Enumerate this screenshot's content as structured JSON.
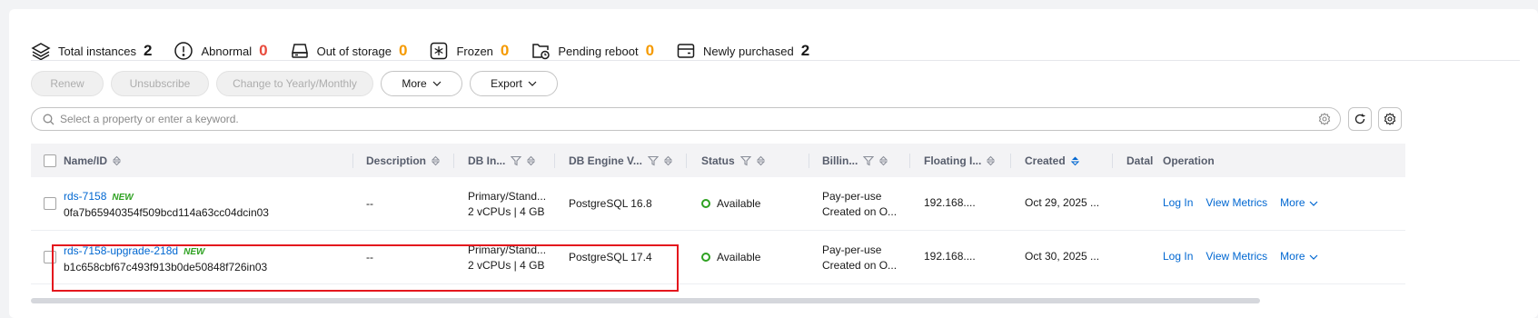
{
  "summary": [
    {
      "icon": "layers-icon",
      "label": "Total instances",
      "count": "2",
      "color": "black"
    },
    {
      "icon": "exclamation-circle-icon",
      "label": "Abnormal",
      "count": "0",
      "color": "red"
    },
    {
      "icon": "storage-icon",
      "label": "Out of storage",
      "count": "0",
      "color": "orange"
    },
    {
      "icon": "frozen-icon",
      "label": "Frozen",
      "count": "0",
      "color": "orange"
    },
    {
      "icon": "pending-reboot-icon",
      "label": "Pending reboot",
      "count": "0",
      "color": "orange"
    },
    {
      "icon": "wallet-icon",
      "label": "Newly purchased",
      "count": "2",
      "color": "black"
    }
  ],
  "toolbar": {
    "renew": "Renew",
    "unsubscribe": "Unsubscribe",
    "change": "Change to Yearly/Monthly",
    "more": "More",
    "export": "Export"
  },
  "search": {
    "placeholder": "Select a property or enter a keyword."
  },
  "columns": {
    "name": "Name/ID",
    "description": "Description",
    "db_instance": "DB In...",
    "engine": "DB Engine V...",
    "status": "Status",
    "billing": "Billin...",
    "floating": "Floating I...",
    "created": "Created",
    "datastore": "Datal",
    "operation": "Operation"
  },
  "rows": [
    {
      "name": "rds-7158",
      "tag": "NEW",
      "id": "0fa7b65940354f509bcd114a63cc04dcin03",
      "description": "--",
      "instance_type": "Primary/Stand...",
      "spec": "2 vCPUs | 4 GB",
      "engine": "PostgreSQL 16.8",
      "status": "Available",
      "billing_mode": "Pay-per-use",
      "billing_created": "Created on O...",
      "floating_ip": "192.168....",
      "created": "Oct 29, 2025 ...",
      "op_login": "Log In",
      "op_metrics": "View Metrics",
      "op_more": "More"
    },
    {
      "name": "rds-7158-upgrade-218d",
      "tag": "NEW",
      "id": "b1c658cbf67c493f913b0de50848f726in03",
      "description": "--",
      "instance_type": "Primary/Stand...",
      "spec": "2 vCPUs | 4 GB",
      "engine": "PostgreSQL 17.4",
      "status": "Available",
      "billing_mode": "Pay-per-use",
      "billing_created": "Created on O...",
      "floating_ip": "192.168....",
      "created": "Oct 30, 2025 ...",
      "op_login": "Log In",
      "op_metrics": "View Metrics",
      "op_more": "More"
    }
  ],
  "colors": {
    "link": "#0067d1",
    "available": "#2ea121",
    "abnormal": "#e84a3c",
    "warning": "#f59a00",
    "highlight": "#e4171d"
  }
}
